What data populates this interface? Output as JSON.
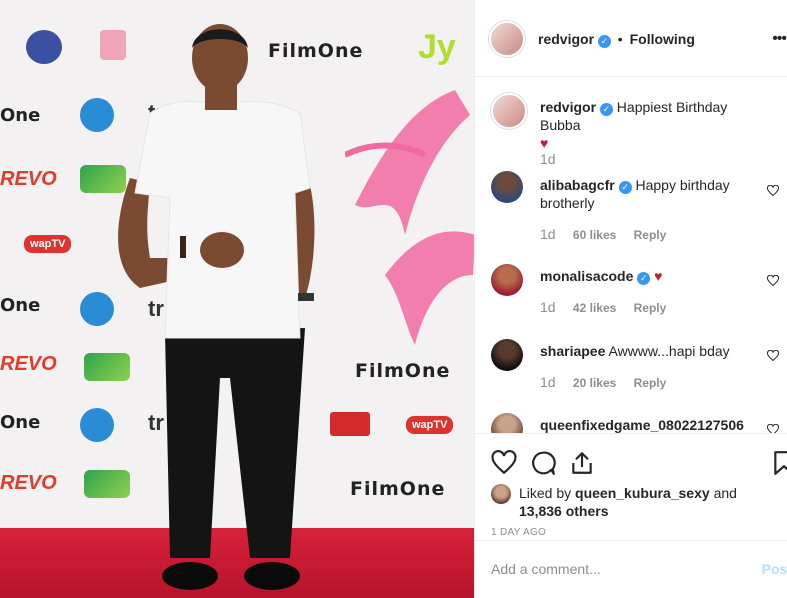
{
  "post": {
    "username": "redvigor",
    "follow_separator": "•",
    "follow_status": "Following",
    "more_icon": "more-options-icon"
  },
  "photo_text": {
    "filmone": "FilmOne",
    "one": "One",
    "revo": "REVO",
    "wap": "wapTV",
    "jy": "Jy",
    "try": "tr"
  },
  "caption": {
    "username": "redvigor",
    "text": "Happiest Birthday Bubba",
    "emoji": "♥",
    "time": "1d"
  },
  "comments": [
    {
      "username": "alibabagcfr",
      "verified": true,
      "text": "Happy birthday brotherly",
      "time": "1d",
      "likes": "60 likes",
      "reply": "Reply"
    },
    {
      "username": "monalisacode",
      "verified": true,
      "text": "♥",
      "time": "1d",
      "likes": "42 likes",
      "reply": "Reply"
    },
    {
      "username": "shariapee",
      "verified": false,
      "text": "Awwww...hapi bday",
      "time": "1d",
      "likes": "20 likes",
      "reply": "Reply"
    },
    {
      "username": "queenfixedgame_08022127506",
      "verified": false,
      "text": "",
      "time": "",
      "likes": "",
      "reply": ""
    }
  ],
  "liked": {
    "prefix": "Liked by",
    "user": "queen_kubura_sexy",
    "and": "and",
    "others": "13,836 others"
  },
  "timeago": "1 DAY AGO",
  "add_comment": {
    "placeholder": "Add a comment...",
    "post_label": "Post"
  },
  "colors": {
    "accent": "#3897f0",
    "heart": "#c2203b",
    "carpet": "#d8213a",
    "post_disabled": "#b2dffc"
  }
}
